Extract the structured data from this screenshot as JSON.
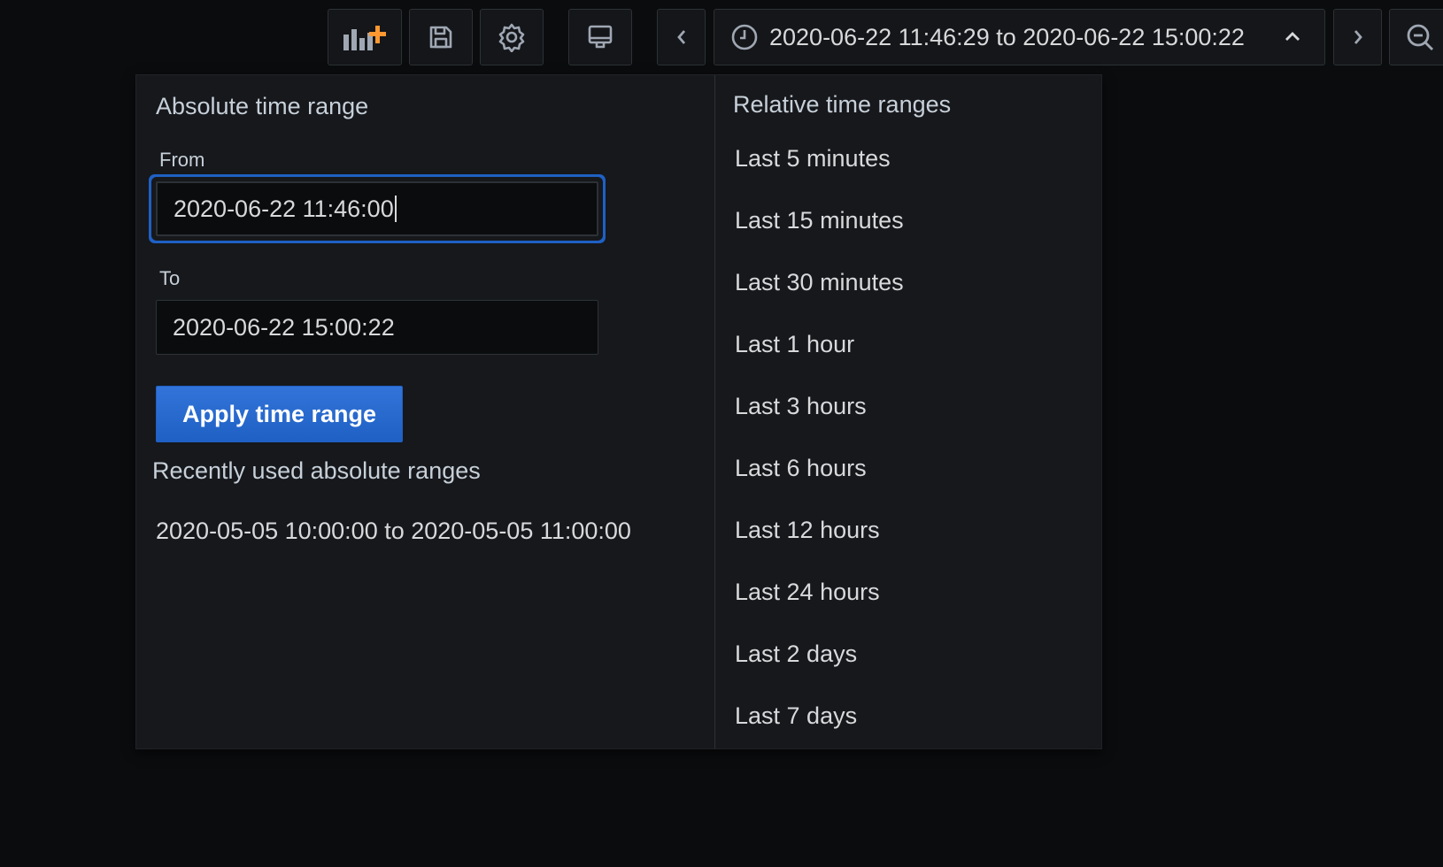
{
  "toolbar": {
    "add_panel_icon": "add-panel-icon",
    "save_icon": "save-icon",
    "settings_icon": "gear-icon",
    "tv_mode_icon": "monitor-icon",
    "shift_back_icon": "chevron-left-icon",
    "time_range_label": "2020-06-22 11:46:29 to 2020-06-22 15:00:22",
    "shift_forward_icon": "chevron-right-icon",
    "zoom_out_icon": "zoom-out-icon",
    "accent_color": "#ff9830"
  },
  "absolute": {
    "title": "Absolute time range",
    "from_label": "From",
    "from_value": "2020-06-22 11:46:00",
    "to_label": "To",
    "to_value": "2020-06-22 15:00:22",
    "apply_label": "Apply time range",
    "recent_title": "Recently used absolute ranges",
    "recent_items": [
      "2020-05-05 10:00:00 to 2020-05-05 11:00:00"
    ]
  },
  "relative": {
    "title": "Relative time ranges",
    "items": [
      "Last 5 minutes",
      "Last 15 minutes",
      "Last 30 minutes",
      "Last 1 hour",
      "Last 3 hours",
      "Last 6 hours",
      "Last 12 hours",
      "Last 24 hours",
      "Last 2 days",
      "Last 7 days"
    ]
  },
  "colors": {
    "primary_button": "#1f60c4",
    "focus_ring": "#1f60c4",
    "panel_bg": "#16181c",
    "page_bg": "#0b0c0e"
  }
}
